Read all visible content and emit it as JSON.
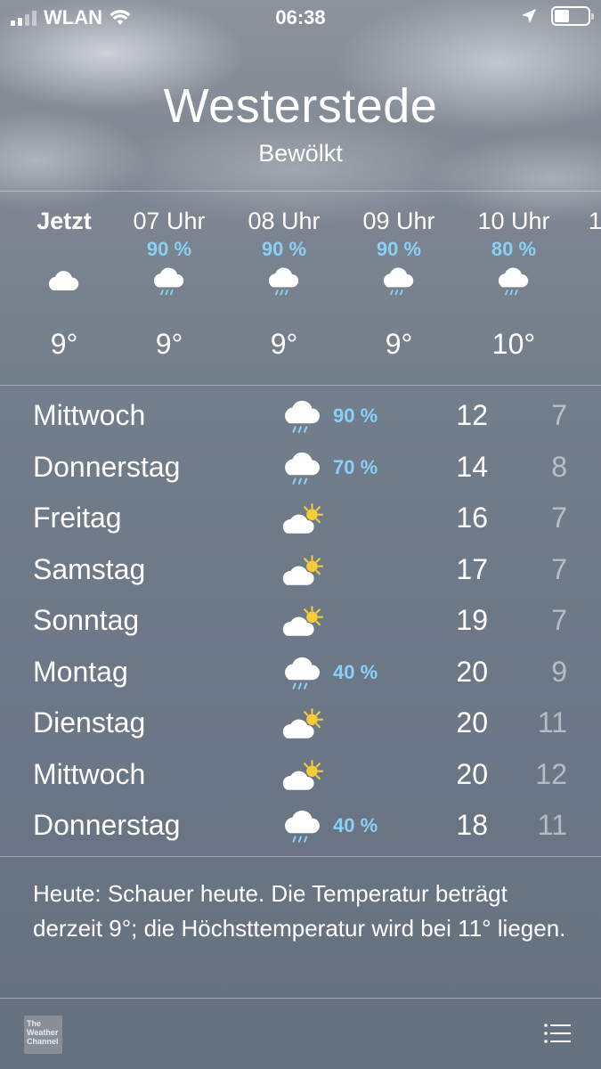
{
  "status_bar": {
    "carrier": "WLAN",
    "time": "06:38"
  },
  "location": {
    "city": "Westerstede",
    "condition": "Bewölkt"
  },
  "hourly": [
    {
      "label": "Jetzt",
      "precip": "",
      "icon": "cloud-icon",
      "temp": "9°"
    },
    {
      "label": "07 Uhr",
      "precip": "90 %",
      "icon": "rain-cloud-icon",
      "temp": "9°"
    },
    {
      "label": "08 Uhr",
      "precip": "90 %",
      "icon": "rain-cloud-icon",
      "temp": "9°"
    },
    {
      "label": "09 Uhr",
      "precip": "90 %",
      "icon": "rain-cloud-icon",
      "temp": "9°"
    },
    {
      "label": "10 Uhr",
      "precip": "80 %",
      "icon": "rain-cloud-icon",
      "temp": "10°"
    },
    {
      "label": "1",
      "precip": "",
      "icon": "",
      "temp": ""
    }
  ],
  "daily": [
    {
      "day": "Mittwoch",
      "icon": "rain-cloud-icon",
      "precip": "90 %",
      "high": "12",
      "low": "7"
    },
    {
      "day": "Donnerstag",
      "icon": "rain-cloud-icon",
      "precip": "70 %",
      "high": "14",
      "low": "8"
    },
    {
      "day": "Freitag",
      "icon": "partly-sunny-icon",
      "precip": "",
      "high": "16",
      "low": "7"
    },
    {
      "day": "Samstag",
      "icon": "partly-sunny-icon",
      "precip": "",
      "high": "17",
      "low": "7"
    },
    {
      "day": "Sonntag",
      "icon": "partly-sunny-icon",
      "precip": "",
      "high": "19",
      "low": "7"
    },
    {
      "day": "Montag",
      "icon": "rain-cloud-icon",
      "precip": "40 %",
      "high": "20",
      "low": "9"
    },
    {
      "day": "Dienstag",
      "icon": "partly-sunny-icon",
      "precip": "",
      "high": "20",
      "low": "11"
    },
    {
      "day": "Mittwoch",
      "icon": "partly-sunny-icon",
      "precip": "",
      "high": "20",
      "low": "12"
    },
    {
      "day": "Donnerstag",
      "icon": "rain-cloud-icon",
      "precip": "40 %",
      "high": "18",
      "low": "11"
    }
  ],
  "summary": "Heute: Schauer heute. Die Temperatur beträgt derzeit 9°; die Höchsttemperatur wird bei 11° liegen.",
  "footer": {
    "logo_lines": [
      "The",
      "Weather",
      "Channel"
    ]
  },
  "colors": {
    "precip_accent": "#8ad0f6",
    "sun": "#f5cc3a"
  }
}
